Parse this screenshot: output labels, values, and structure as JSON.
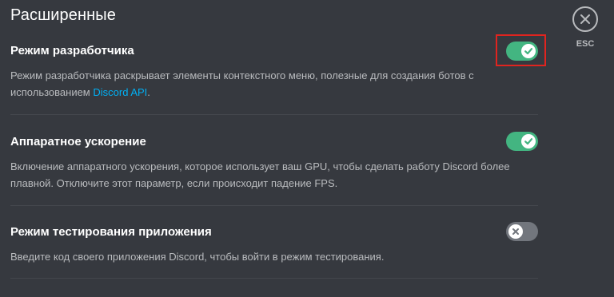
{
  "page": {
    "title": "Расширенные",
    "close_label": "ESC"
  },
  "settings": [
    {
      "title": "Режим разработчика",
      "desc_text": "Режим разработчика раскрывает элементы контекстного меню, полезные для создания ботов с использованием",
      "desc_link": "Discord API",
      "desc_end": ".",
      "enabled": true,
      "highlighted": true
    },
    {
      "title": "Аппаратное ускорение",
      "desc_text": "Включение аппаратного ускорения, которое использует ваш GPU, чтобы сделать работу Discord более плавной. Отключите этот параметр, если происходит падение FPS.",
      "enabled": true
    },
    {
      "title": "Режим тестирования приложения",
      "desc_text": "Введите код своего приложения Discord, чтобы войти в режим тестирования.",
      "enabled": false
    }
  ],
  "colors": {
    "background": "#36393f",
    "toggle_on": "#43b581",
    "toggle_off": "#72767d",
    "link": "#00b0f4",
    "highlight": "#e0241f"
  },
  "icons": {
    "close": "close-icon",
    "check": "check-icon",
    "x": "x-icon"
  }
}
